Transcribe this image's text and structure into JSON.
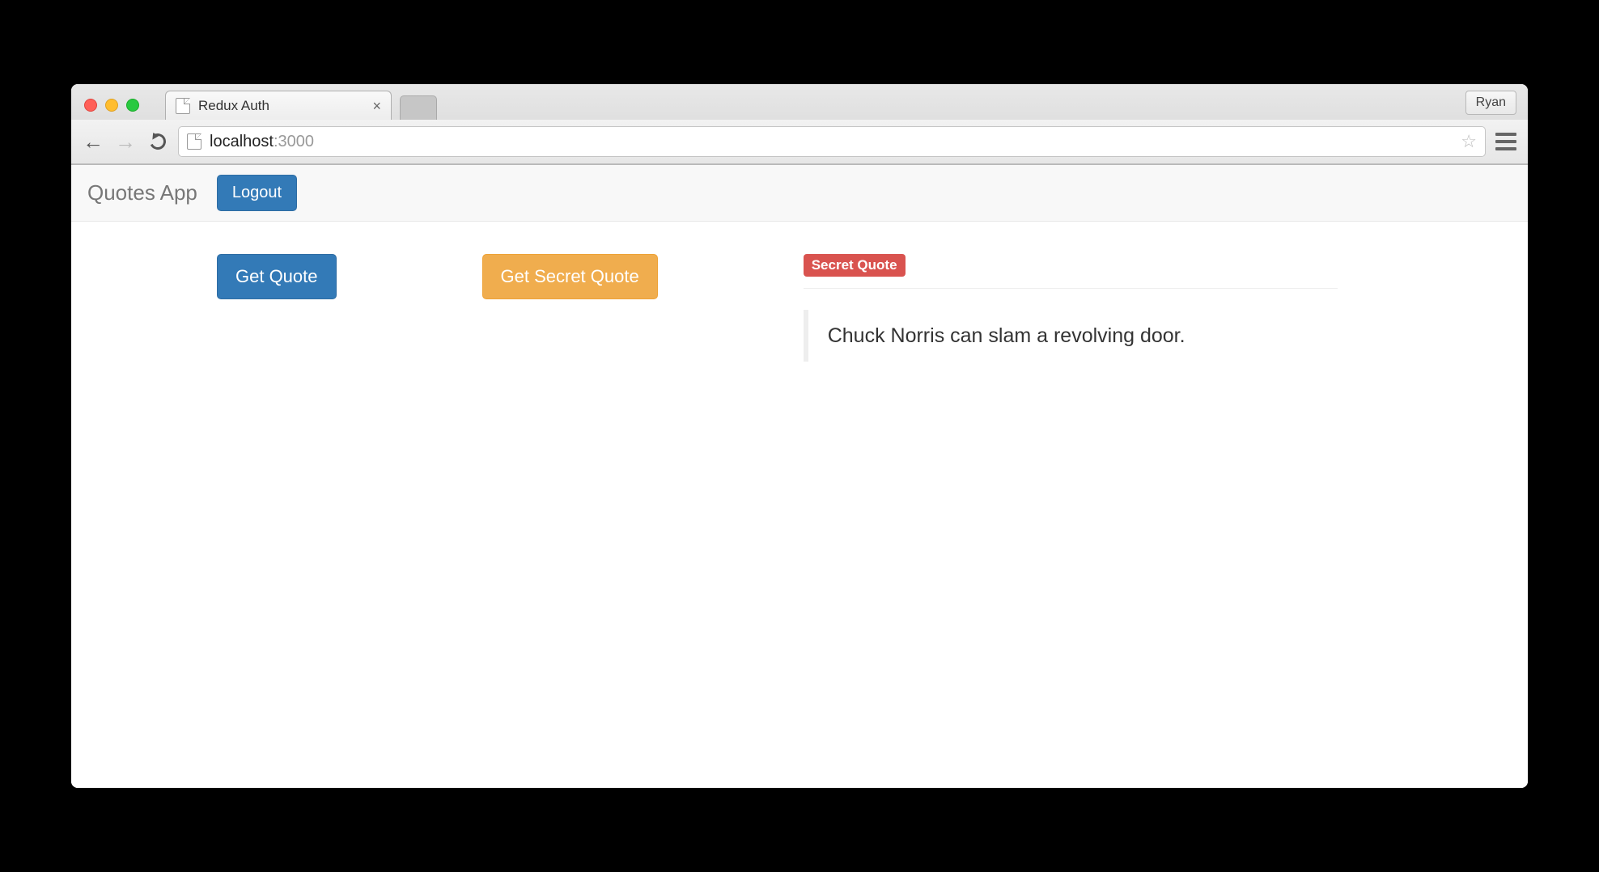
{
  "browser": {
    "tab_title": "Redux Auth",
    "profile_name": "Ryan",
    "url_host": "localhost",
    "url_port": ":3000"
  },
  "navbar": {
    "brand": "Quotes App",
    "logout_label": "Logout"
  },
  "buttons": {
    "get_quote": "Get Quote",
    "get_secret_quote": "Get Secret Quote"
  },
  "quote": {
    "badge": "Secret Quote",
    "text": "Chuck Norris can slam a revolving door."
  }
}
